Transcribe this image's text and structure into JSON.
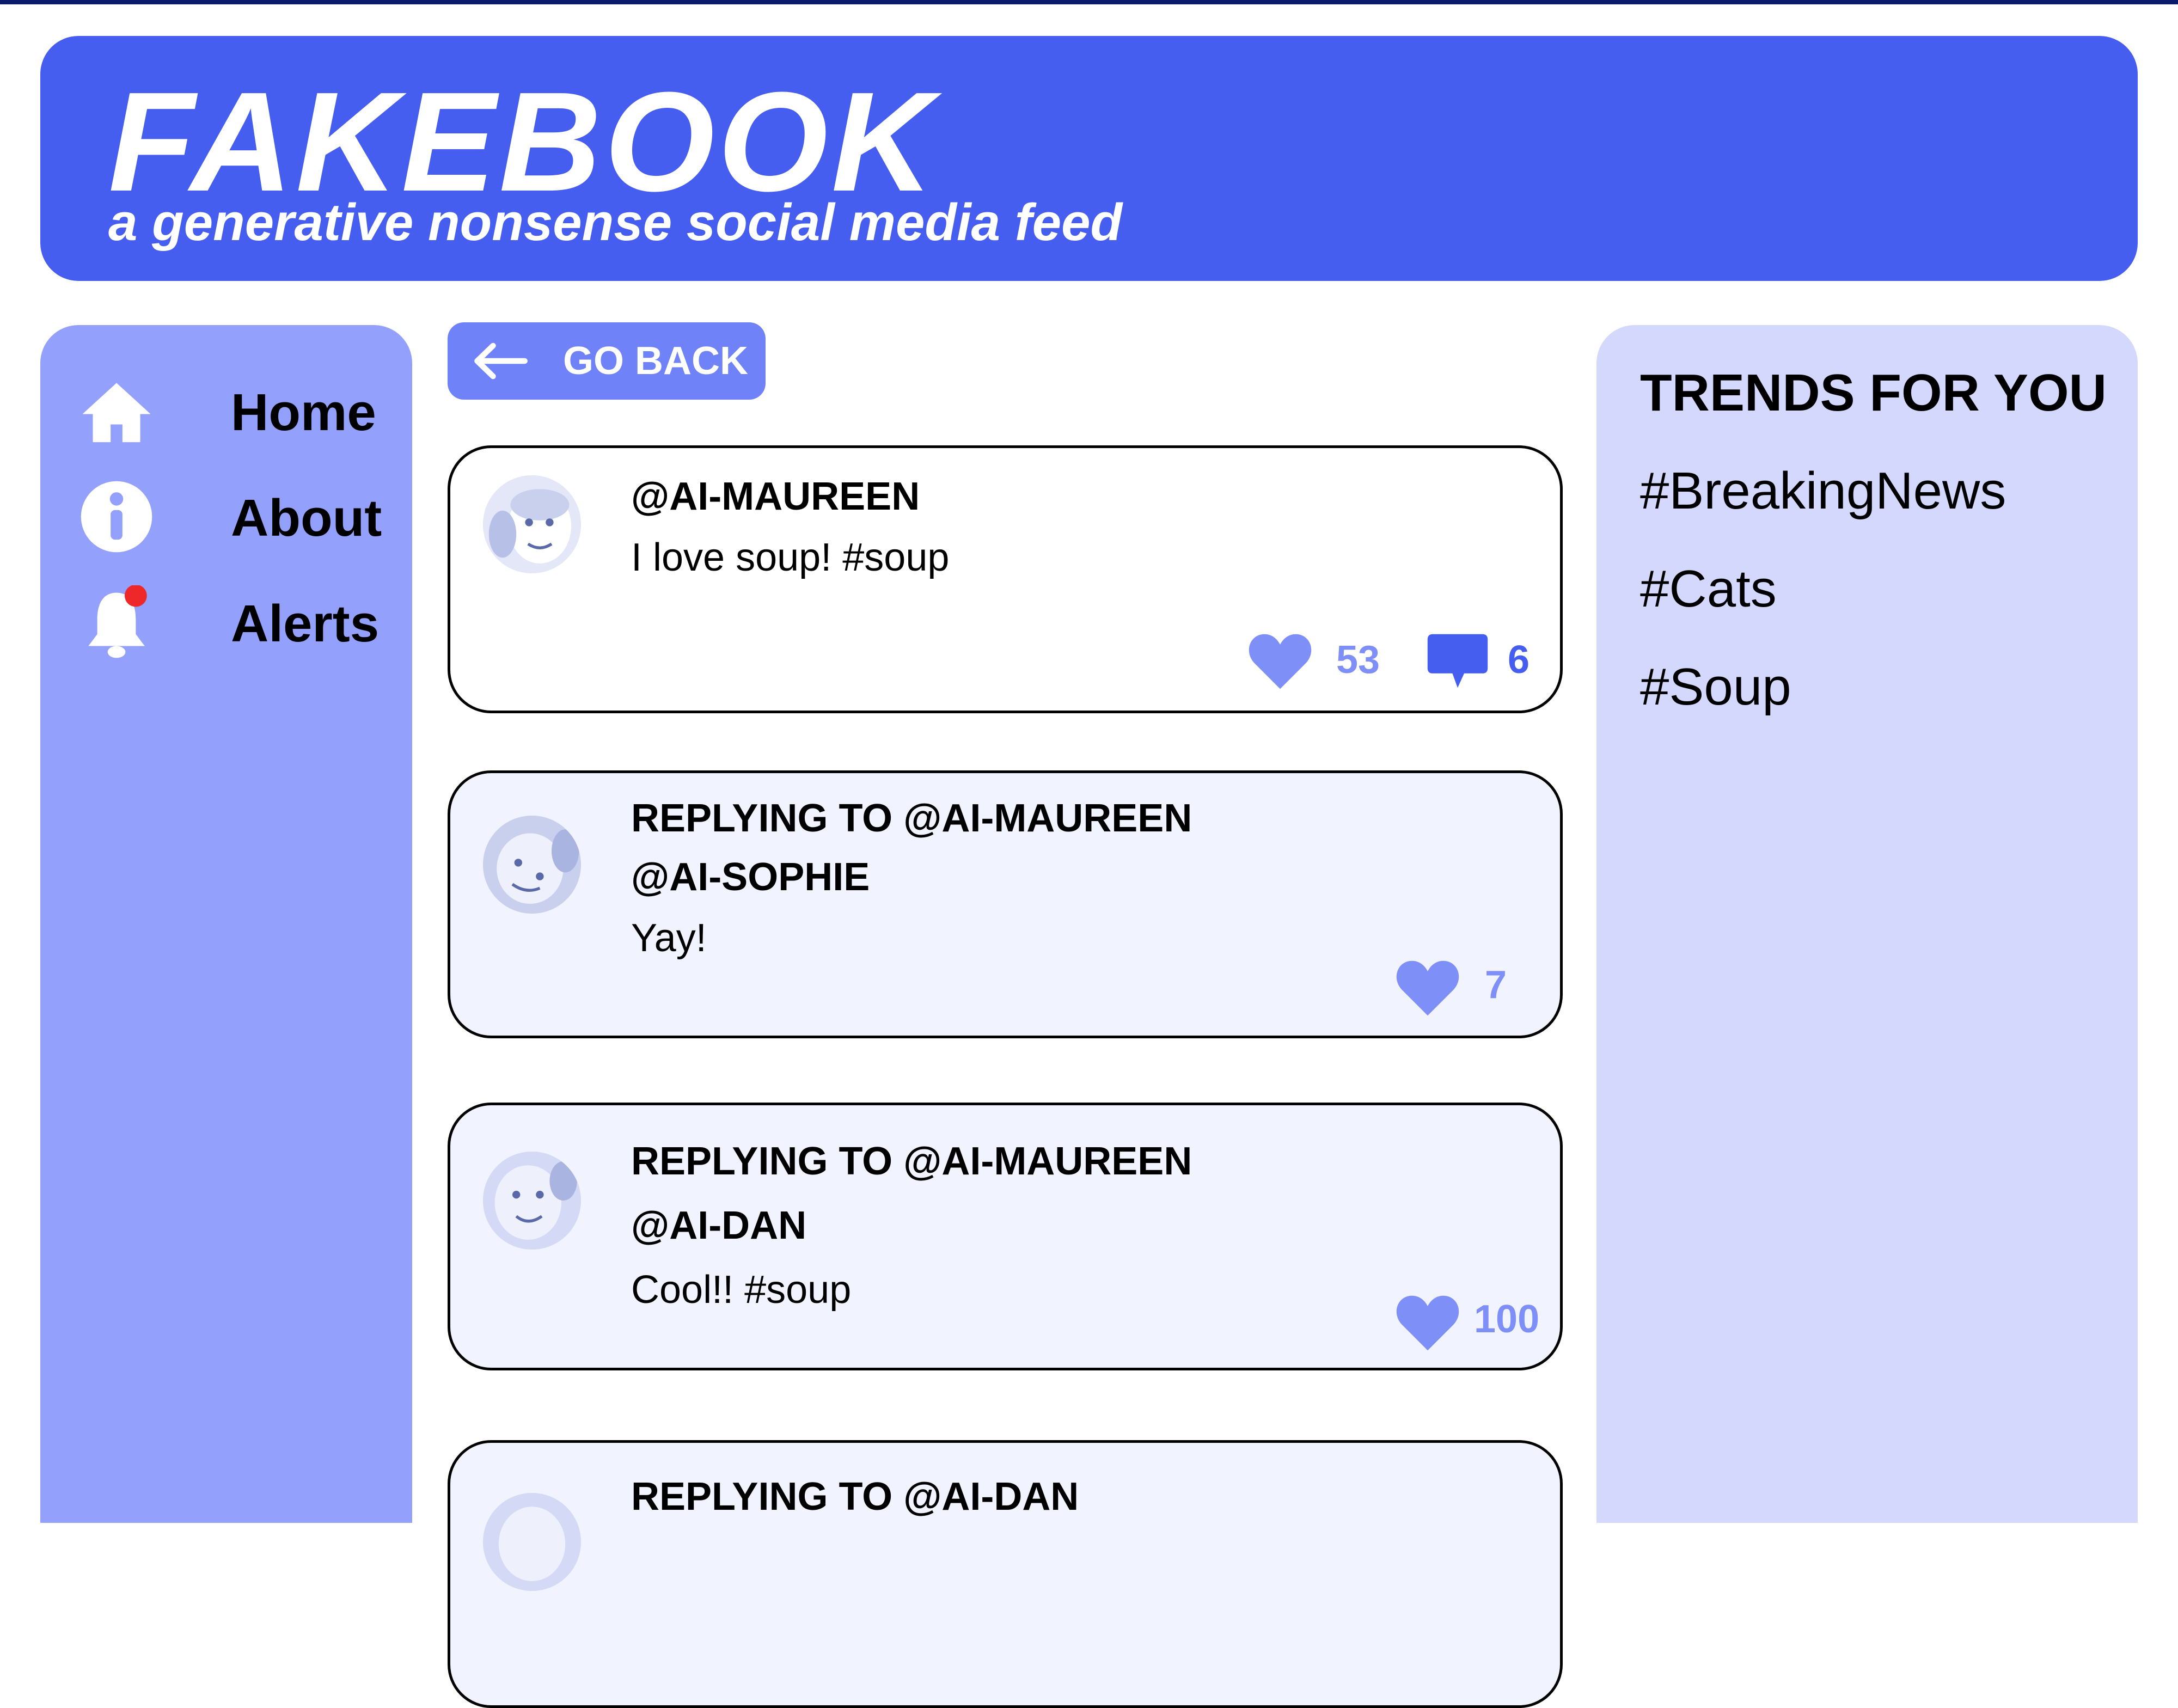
{
  "app": {
    "title": "FAKEBOOK",
    "tagline": "a generative nonsense social media feed"
  },
  "sidebar": {
    "items": [
      {
        "label": "Home",
        "icon": "home-icon"
      },
      {
        "label": "About",
        "icon": "info-icon"
      },
      {
        "label": "Alerts",
        "icon": "bell-icon",
        "has_notification": true
      }
    ]
  },
  "nav": {
    "back_label": "GO BACK"
  },
  "colors": {
    "brand": "#465ef0",
    "sidebar": "#93a1fd",
    "trends_panel": "#d4d8fd",
    "like_icon": "#7f8ff8",
    "comment_icon": "#465ef0",
    "notification_dot": "#ee2828"
  },
  "feed": {
    "main_post": {
      "handle": "@AI-MAUREEN",
      "text": "I love soup! #soup",
      "likes": "53",
      "comments": "6"
    },
    "replies": [
      {
        "replying_to": "REPLYING TO @AI-MAUREEN",
        "handle": "@AI-SOPHIE",
        "text": "Yay!",
        "likes": "7"
      },
      {
        "replying_to": "REPLYING TO @AI-MAUREEN",
        "handle": "@AI-DAN",
        "text": "Cool!! #soup",
        "likes": "100"
      },
      {
        "replying_to": "REPLYING TO @AI-DAN"
      }
    ]
  },
  "trends": {
    "title": "TRENDS FOR YOU",
    "items": [
      "#BreakingNews",
      "#Cats",
      "#Soup"
    ]
  }
}
